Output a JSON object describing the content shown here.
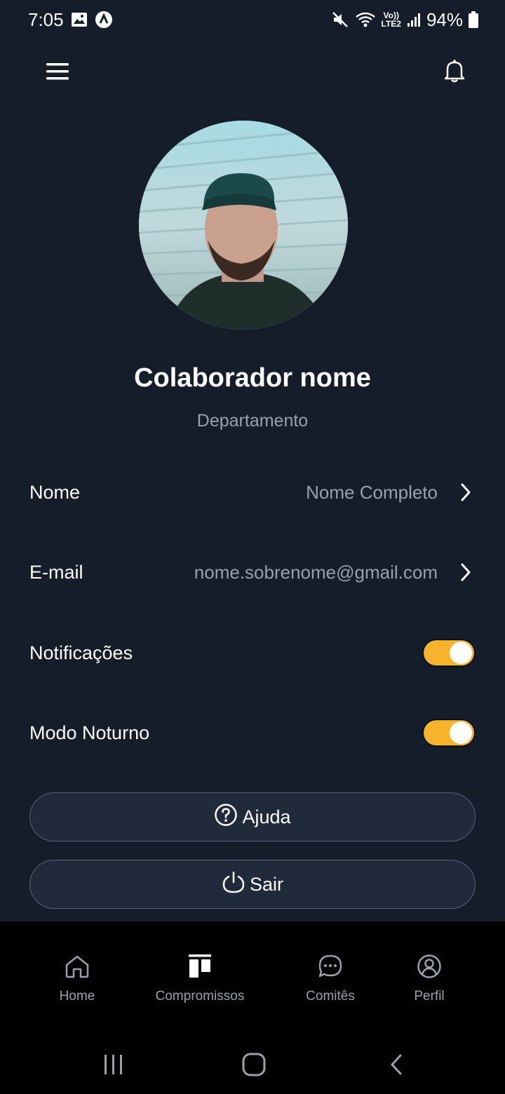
{
  "status_bar": {
    "time": "7:05",
    "battery": "94%",
    "network_top": "Vo))",
    "network_bottom": "LTE2",
    "icons": [
      "gallery-icon",
      "app-notification-icon",
      "mute-icon",
      "wifi-icon",
      "signal-icon",
      "battery-icon"
    ]
  },
  "header": {
    "menu_icon": "hamburger-menu-icon",
    "bell_icon": "bell-icon"
  },
  "profile": {
    "name": "Colaborador nome",
    "department": "Departamento"
  },
  "settings": {
    "name_label": "Nome",
    "name_value": "Nome Completo",
    "email_label": "E-mail",
    "email_value": "nome.sobrenome@gmail.com",
    "notifications_label": "Notificações",
    "notifications_on": true,
    "dark_mode_label": "Modo Noturno",
    "dark_mode_on": true
  },
  "actions": {
    "help_label": "Ajuda",
    "logout_label": "Sair"
  },
  "bottom_nav": {
    "items": [
      {
        "label": "Home",
        "icon": "home-icon"
      },
      {
        "label": "Compromissos",
        "icon": "board-icon"
      },
      {
        "label": "Comitês",
        "icon": "chat-icon"
      },
      {
        "label": "Perfil",
        "icon": "profile-icon"
      }
    ]
  },
  "colors": {
    "background": "#151c2a",
    "accent": "#f7b32b",
    "muted_text": "#9aa1ad",
    "button_bg": "#212a3b",
    "nav_bg": "#000000"
  }
}
